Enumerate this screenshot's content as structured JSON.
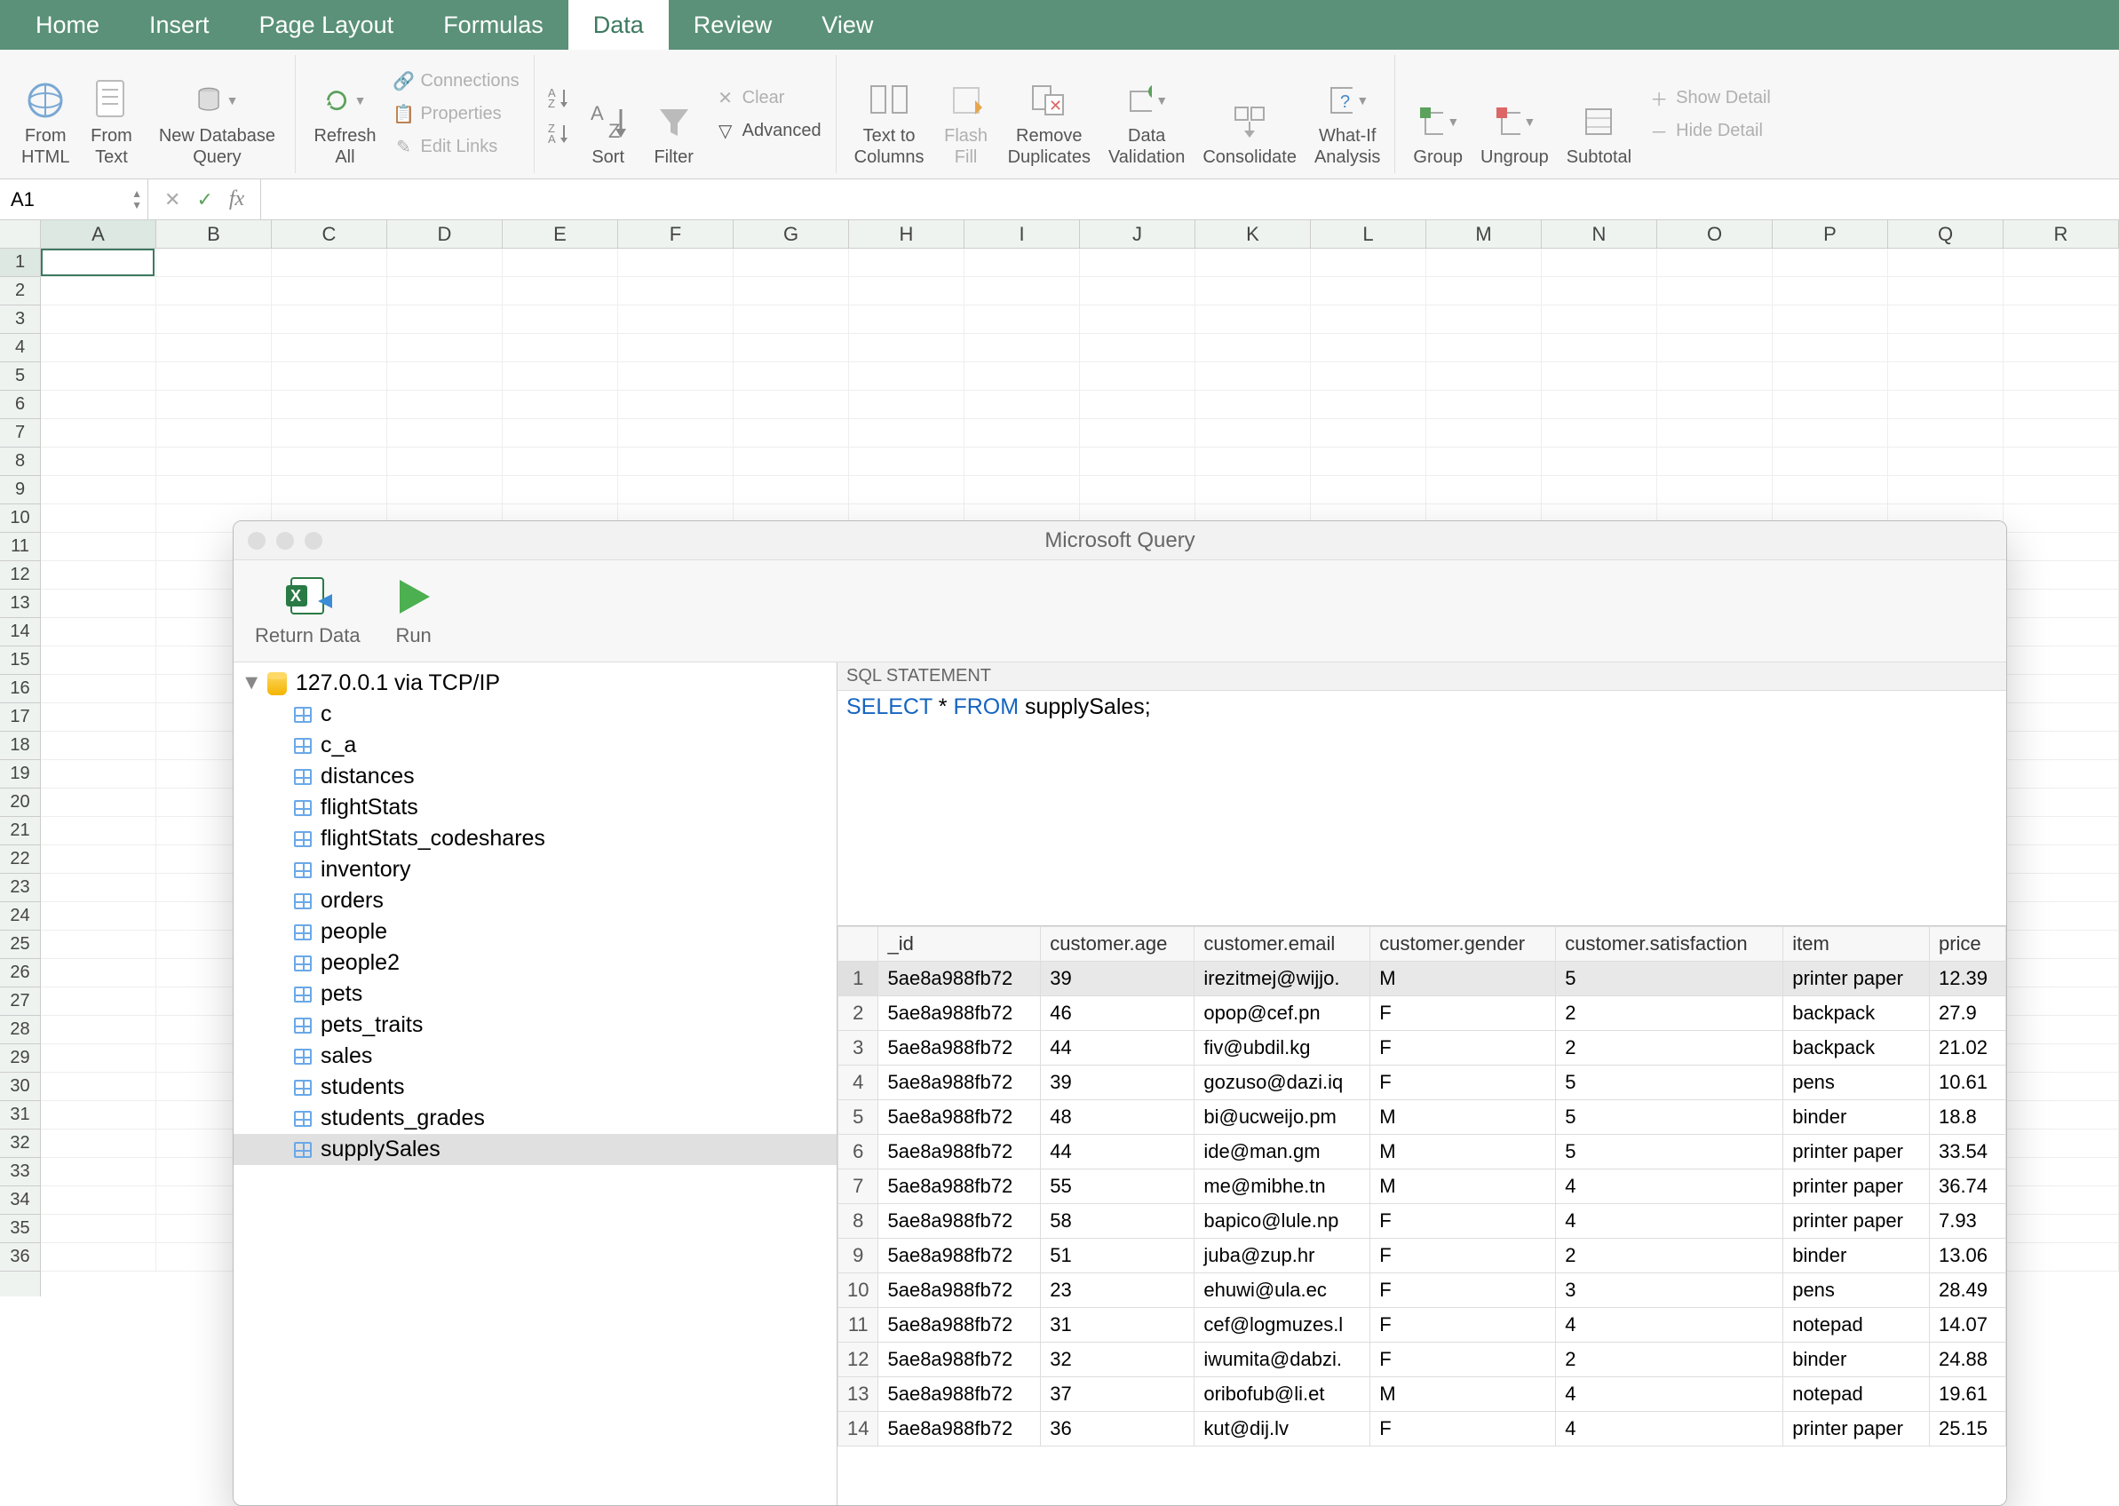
{
  "ribbon": {
    "tabs": [
      "Home",
      "Insert",
      "Page Layout",
      "Formulas",
      "Data",
      "Review",
      "View"
    ],
    "active_tab": "Data",
    "buttons": {
      "from_html": "From\nHTML",
      "from_text": "From\nText",
      "new_db_query": "New Database\nQuery",
      "refresh_all": "Refresh\nAll",
      "connections": "Connections",
      "properties": "Properties",
      "edit_links": "Edit Links",
      "sort": "Sort",
      "filter": "Filter",
      "clear": "Clear",
      "advanced": "Advanced",
      "text_to_columns": "Text to\nColumns",
      "flash_fill": "Flash\nFill",
      "remove_duplicates": "Remove\nDuplicates",
      "data_validation": "Data\nValidation",
      "consolidate": "Consolidate",
      "what_if": "What-If\nAnalysis",
      "group": "Group",
      "ungroup": "Ungroup",
      "subtotal": "Subtotal",
      "show_detail": "Show Detail",
      "hide_detail": "Hide Detail"
    }
  },
  "formula_bar": {
    "name_box": "A1",
    "fx": "fx",
    "value": ""
  },
  "columns": [
    "A",
    "B",
    "C",
    "D",
    "E",
    "F",
    "G",
    "H",
    "I",
    "J",
    "K",
    "L",
    "M",
    "N",
    "O",
    "P",
    "Q",
    "R"
  ],
  "rows": 36,
  "query_window": {
    "title": "Microsoft Query",
    "return_data": "Return Data",
    "run": "Run",
    "connection": "127.0.0.1 via TCP/IP",
    "tables": [
      "c",
      "c_a",
      "distances",
      "flightStats",
      "flightStats_codeshares",
      "inventory",
      "orders",
      "people",
      "people2",
      "pets",
      "pets_traits",
      "sales",
      "students",
      "students_grades",
      "supplySales"
    ],
    "selected_table": "supplySales",
    "sql_header": "SQL STATEMENT",
    "sql_parts": {
      "kw1": "SELECT",
      "star": " * ",
      "kw2": "FROM",
      "rest": " supplySales;"
    },
    "result_columns": [
      "_id",
      "customer.age",
      "customer.email",
      "customer.gender",
      "customer.satisfaction",
      "item",
      "price"
    ],
    "result_rows": [
      [
        "5ae8a988fb72",
        "39",
        "irezitmej@wijjo.",
        "M",
        "5",
        "printer paper",
        "12.39"
      ],
      [
        "5ae8a988fb72",
        "46",
        "opop@cef.pn",
        "F",
        "2",
        "backpack",
        "27.9"
      ],
      [
        "5ae8a988fb72",
        "44",
        "fiv@ubdil.kg",
        "F",
        "2",
        "backpack",
        "21.02"
      ],
      [
        "5ae8a988fb72",
        "39",
        "gozuso@dazi.iq",
        "F",
        "5",
        "pens",
        "10.61"
      ],
      [
        "5ae8a988fb72",
        "48",
        "bi@ucweijo.pm",
        "M",
        "5",
        "binder",
        "18.8"
      ],
      [
        "5ae8a988fb72",
        "44",
        "ide@man.gm",
        "M",
        "5",
        "printer paper",
        "33.54"
      ],
      [
        "5ae8a988fb72",
        "55",
        "me@mibhe.tn",
        "M",
        "4",
        "printer paper",
        "36.74"
      ],
      [
        "5ae8a988fb72",
        "58",
        "bapico@lule.np",
        "F",
        "4",
        "printer paper",
        "7.93"
      ],
      [
        "5ae8a988fb72",
        "51",
        "juba@zup.hr",
        "F",
        "2",
        "binder",
        "13.06"
      ],
      [
        "5ae8a988fb72",
        "23",
        "ehuwi@ula.ec",
        "F",
        "3",
        "pens",
        "28.49"
      ],
      [
        "5ae8a988fb72",
        "31",
        "cef@logmuzes.l",
        "F",
        "4",
        "notepad",
        "14.07"
      ],
      [
        "5ae8a988fb72",
        "32",
        "iwumita@dabzi.",
        "F",
        "2",
        "binder",
        "24.88"
      ],
      [
        "5ae8a988fb72",
        "37",
        "oribofub@li.et",
        "M",
        "4",
        "notepad",
        "19.61"
      ],
      [
        "5ae8a988fb72",
        "36",
        "kut@dij.lv",
        "F",
        "4",
        "printer paper",
        "25.15"
      ]
    ]
  }
}
